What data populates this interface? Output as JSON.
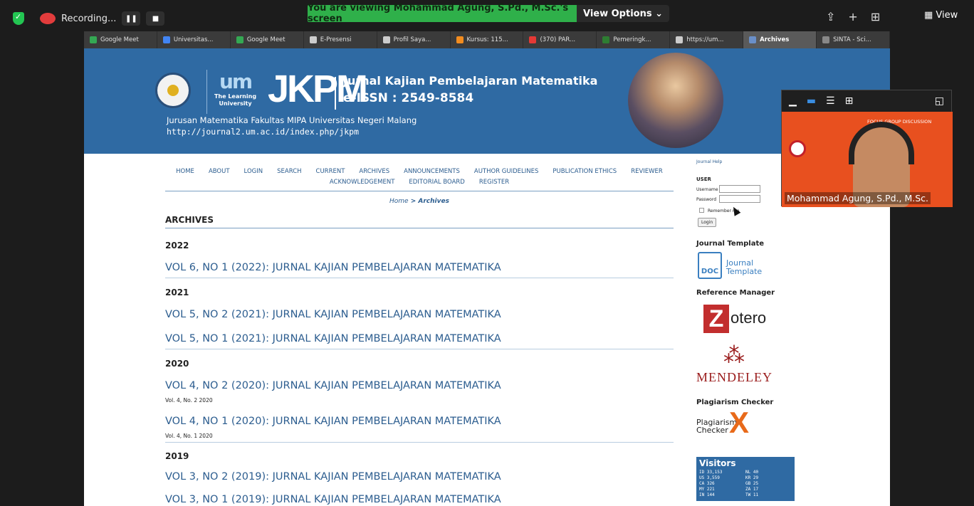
{
  "zoom": {
    "recording_label": "Recording...",
    "banner": "You are viewing Mohammad Agung, S.Pd., M.Sc.'s screen",
    "view_options": "View Options ⌄",
    "view_button": "View",
    "icons": [
      "share-icon",
      "plus-icon",
      "grid-icon"
    ]
  },
  "tabs": [
    {
      "label": "Google Meet",
      "color": "#34a853"
    },
    {
      "label": "Universitas...",
      "color": "#4285f4"
    },
    {
      "label": "Google Meet",
      "color": "#34a853"
    },
    {
      "label": "E-Presensi",
      "color": "#cccccc"
    },
    {
      "label": "Profil Saya...",
      "color": "#cccccc"
    },
    {
      "label": "Kursus: 115...",
      "color": "#f28c1f"
    },
    {
      "label": "(370) PAR...",
      "color": "#e53935"
    },
    {
      "label": "Pemeringk...",
      "color": "#2e7d32"
    },
    {
      "label": "https://um...",
      "color": "#cccccc"
    },
    {
      "label": "Archives",
      "color": "#6a8fc8",
      "active": true
    },
    {
      "label": "SINTA - Sci...",
      "color": "#888888"
    }
  ],
  "header": {
    "um_text": "um",
    "um_tagline": "The Learning University",
    "jkpm": "JKPM",
    "title": "Jurnal Kajian Pembelajaran Matematika",
    "issn": "e-ISSN : 2549-8584",
    "department": "Jurusan Matematika Fakultas MIPA Universitas Negeri Malang",
    "url": "http://journal2.um.ac.id/index.php/jkpm"
  },
  "nav": {
    "row1": [
      "HOME",
      "ABOUT",
      "LOGIN",
      "SEARCH",
      "CURRENT",
      "ARCHIVES",
      "ANNOUNCEMENTS",
      "AUTHOR GUIDELINES",
      "PUBLICATION ETHICS",
      "REVIEWER"
    ],
    "row2": [
      "ACKNOWLEDGEMENT",
      "EDITORIAL BOARD",
      "REGISTER"
    ]
  },
  "breadcrumb": {
    "home": "Home",
    "sep": " > ",
    "current": "Archives"
  },
  "page_title": "ARCHIVES",
  "archive": {
    "y2022": "2022",
    "i2022_1": "VOL 6, NO 1 (2022): JURNAL KAJIAN PEMBELAJARAN MATEMATIKA",
    "y2021": "2021",
    "i2021_2": "VOL 5, NO 2 (2021): JURNAL KAJIAN PEMBELAJARAN MATEMATIKA",
    "i2021_1": "VOL 5, NO 1 (2021): JURNAL KAJIAN PEMBELAJARAN MATEMATIKA",
    "y2020": "2020",
    "i2020_2": "VOL 4, NO 2 (2020): JURNAL KAJIAN PEMBELAJARAN MATEMATIKA",
    "i2020_2_sub": "Vol. 4, No. 2 2020",
    "i2020_1": "VOL 4, NO 1 (2020): JURNAL KAJIAN PEMBELAJARAN MATEMATIKA",
    "i2020_1_sub": "Vol. 4, No. 1 2020",
    "y2019": "2019",
    "i2019_2": "VOL 3, NO 2 (2019): JURNAL KAJIAN PEMBELAJARAN MATEMATIKA",
    "i2019_1": "VOL 3, NO 1 (2019): JURNAL KAJIAN PEMBELAJARAN MATEMATIKA"
  },
  "sidebar": {
    "journal_help": "Journal Help",
    "user": "USER",
    "username": "Username",
    "password": "Password",
    "remember": "Remember me",
    "login": "Login",
    "template_head": "Journal Template",
    "doc": "DOC",
    "template_text": "Journal Template",
    "ref_head": "Reference Manager",
    "zotero": "otero",
    "zotero_z": "Z",
    "mendeley": "MENDELEY",
    "plag_head": "Plagiarism Checker",
    "plag_text": "Plagiarism Checker",
    "plag_x": "X",
    "visitors": "Visitors",
    "visitor_stats": [
      "ID 33,153",
      "NL 40",
      "US 3,559",
      "KR 29",
      "CA 326",
      "GB 25",
      "MY 221",
      "ZA 17",
      "IN 144",
      "TW 11"
    ]
  },
  "video": {
    "name": "Mohammad Agung, S.Pd., M.Sc.",
    "banner_text": "FOCUS GROUP DISCUSSION"
  }
}
